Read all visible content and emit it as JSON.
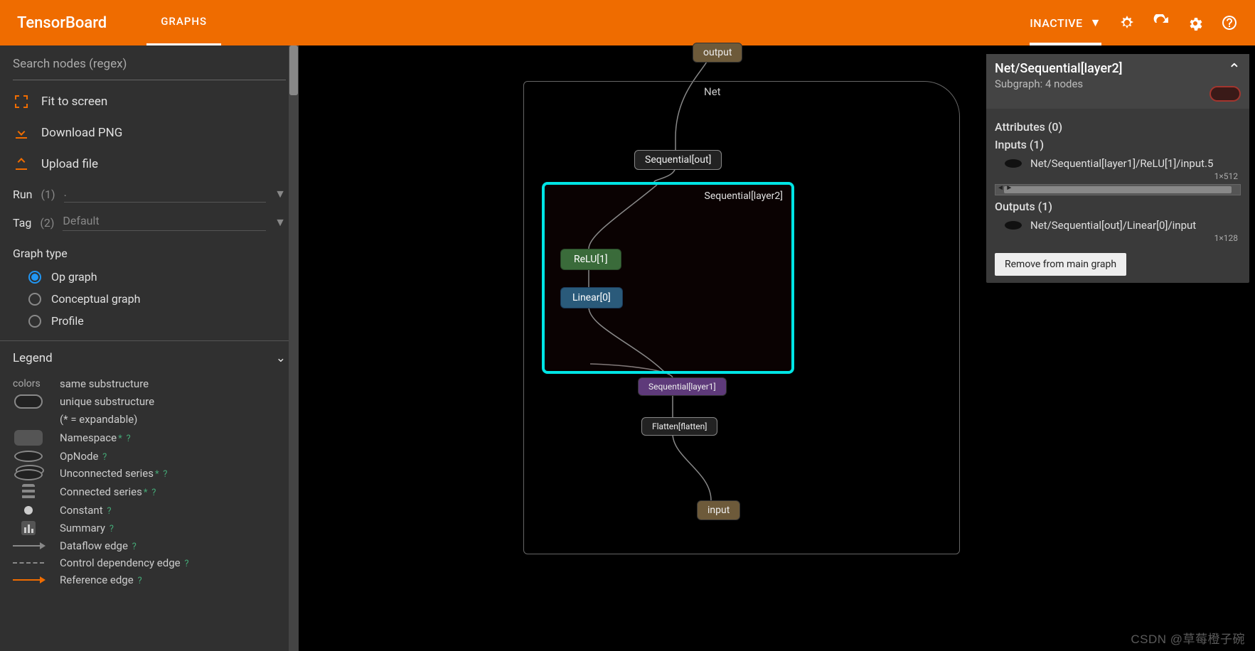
{
  "header": {
    "logo": "TensorBoard",
    "tab": "GRAPHS",
    "status": "INACTIVE"
  },
  "sidebar": {
    "search_placeholder": "Search nodes (regex)",
    "fit": "Fit to screen",
    "download": "Download PNG",
    "upload": "Upload file",
    "run_label": "Run",
    "run_count": "(1)",
    "run_value": ".",
    "tag_label": "Tag",
    "tag_count": "(2)",
    "tag_value": "Default",
    "graph_type_title": "Graph type",
    "graph_types": [
      "Op graph",
      "Conceptual graph",
      "Profile"
    ],
    "legend_title": "Legend",
    "colors_label": "colors",
    "legend": {
      "same_sub": "same substructure",
      "unique_sub": "unique substructure",
      "expandable": "(* = expandable)",
      "namespace": "Namespace",
      "opnode": "OpNode",
      "unconnected": "Unconnected series",
      "connected": "Connected series",
      "constant": "Constant",
      "summary": "Summary",
      "dataflow": "Dataflow edge",
      "control": "Control dependency edge",
      "reference": "Reference edge"
    }
  },
  "graph": {
    "net_label": "Net",
    "output": "output",
    "seq_out": "Sequential[out]",
    "seq_l2": "Sequential[layer2]",
    "relu": "ReLU[1]",
    "linear": "Linear[0]",
    "seq_l1": "Sequential[layer1]",
    "flatten": "Flatten[flatten]",
    "input": "input"
  },
  "info": {
    "title": "Net/Sequential[layer2]",
    "subgraph": "Subgraph: 4 nodes",
    "attributes_label": "Attributes (0)",
    "inputs_label": "Inputs (1)",
    "input_item": "Net/Sequential[layer1]/ReLU[1]/input.5",
    "input_dim": "1×512",
    "outputs_label": "Outputs (1)",
    "output_item": "Net/Sequential[out]/Linear[0]/input",
    "output_dim": "1×128",
    "remove_btn": "Remove from main graph"
  },
  "watermark": "CSDN @草莓橙子碗"
}
